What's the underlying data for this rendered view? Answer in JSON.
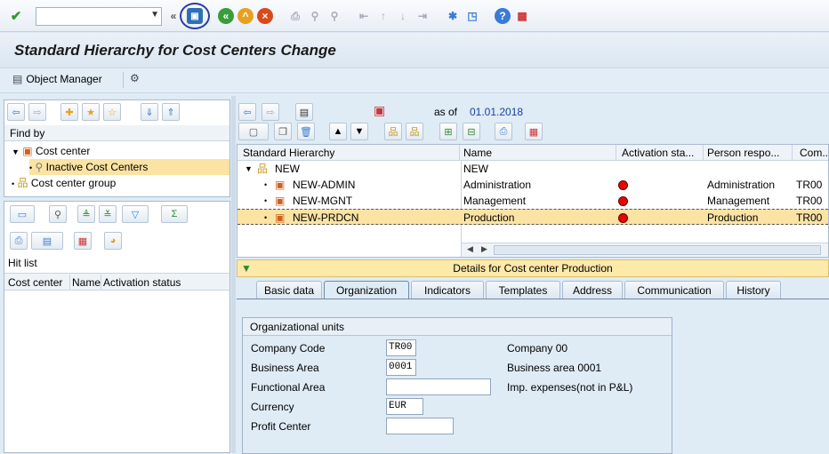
{
  "toolbar": {
    "command_value": "",
    "icons": [
      "check-icon",
      "save-icon",
      "back-icon",
      "exit-icon",
      "cancel-icon",
      "print-icon",
      "find-icon",
      "find-next-icon",
      "first-page-icon",
      "prev-page-icon",
      "next-page-icon",
      "last-page-icon",
      "new-session-icon",
      "shortcut-icon",
      "help-icon",
      "customize-layout-icon"
    ]
  },
  "title": "Standard Hierarchy for Cost Centers Change",
  "appbar": {
    "object_manager": "Object Manager"
  },
  "find_by": {
    "label": "Find by",
    "items": [
      {
        "label": "Cost center"
      },
      {
        "label": "Inactive Cost Centers"
      },
      {
        "label": "Cost center group"
      }
    ]
  },
  "hit_list": {
    "label": "Hit list",
    "columns": [
      "Cost center",
      "Name",
      "Activation status"
    ]
  },
  "hierarchy": {
    "as_of_label": "as of",
    "as_of_date": "01.01.2018",
    "columns": [
      "Standard Hierarchy",
      "Name",
      "Activation sta...",
      "Person respo...",
      "Com..."
    ],
    "rows": [
      {
        "node": "NEW",
        "name": "NEW",
        "status": "",
        "person": "",
        "company": ""
      },
      {
        "node": "NEW-ADMIN",
        "name": "Administration",
        "status": "red",
        "person": "Administration",
        "company": "TR00"
      },
      {
        "node": "NEW-MGNT",
        "name": "Management",
        "status": "red",
        "person": "Management",
        "company": "TR00"
      },
      {
        "node": "NEW-PRDCN",
        "name": "Production",
        "status": "red",
        "person": "Production",
        "company": "TR00"
      }
    ]
  },
  "details": {
    "header": "Details for Cost center Production",
    "tabs": [
      "Basic data",
      "Organization",
      "Indicators",
      "Templates",
      "Address",
      "Communication",
      "History"
    ],
    "active_tab": "Organization",
    "group_title": "Organizational units",
    "fields": [
      {
        "label": "Company Code",
        "value": "TR00",
        "text": "Company 00"
      },
      {
        "label": "Business Area",
        "value": "0001",
        "text": "Business area 0001"
      },
      {
        "label": "Functional Area",
        "value": "",
        "text": "Imp. expenses(not in P&L)"
      },
      {
        "label": "Currency",
        "value": "EUR",
        "text": ""
      },
      {
        "label": "Profit Center",
        "value": "",
        "text": ""
      }
    ]
  },
  "colors": {
    "selected_row": "#fbe3a3",
    "background": "#dfebf5",
    "accent": "#2a3ca8"
  }
}
